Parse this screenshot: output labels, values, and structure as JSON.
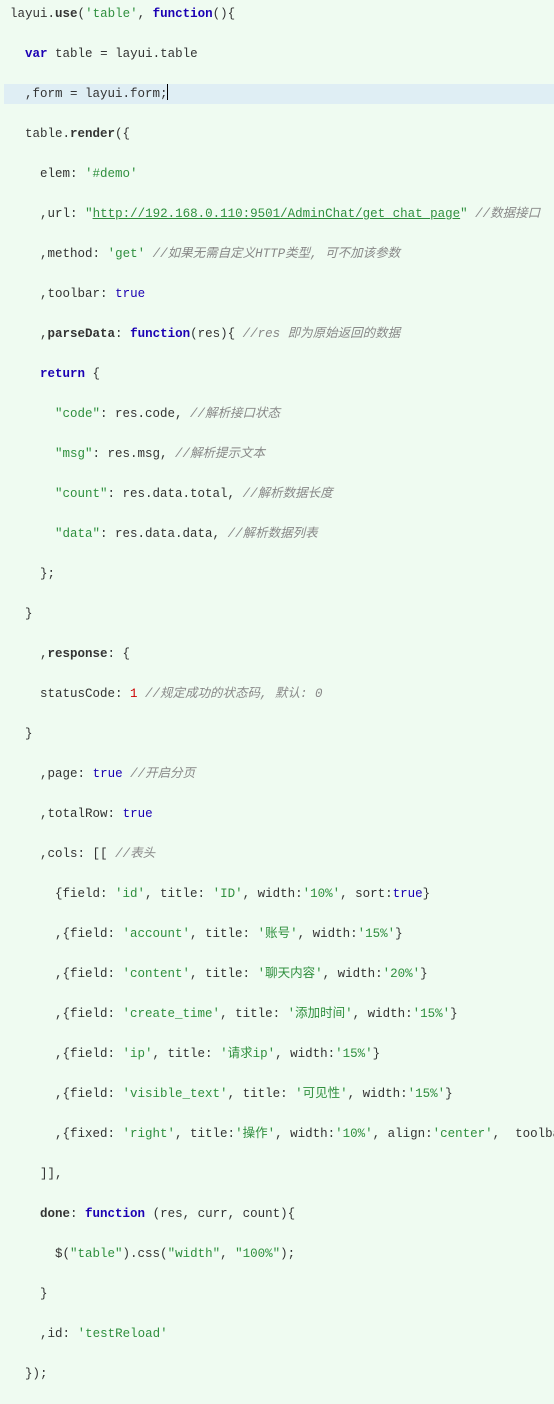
{
  "chart_data": null,
  "code": {
    "l1": {
      "fn": "layui",
      "use": "use",
      "arg": "'table'",
      "kw": "function"
    },
    "l2": {
      "kw": "var",
      "id": "table",
      "rhs": "layui.table"
    },
    "l3": {
      "lhs": ",form",
      "rhs": "layui.form;"
    },
    "l4": {
      "obj": "table.",
      "m": "render",
      "open": "({"
    },
    "l5": {
      "k": "elem",
      "v": "'#demo'"
    },
    "l6": {
      "k": "url",
      "v1": "\"",
      "url": "http://192.168.0.110:9501/AdminChat/get_chat_page",
      "v2": "\"",
      "c": " //数据接口"
    },
    "l7": {
      "k": "method",
      "v": "'get'",
      "c": " //如果无需自定义HTTP类型, 可不加该参数"
    },
    "l8": {
      "k": "toolbar",
      "v": "true"
    },
    "l9": {
      "k": "parseData",
      "fn": "function",
      "arg": "(res){",
      "c": " //res 即为原始返回的数据"
    },
    "l10": {
      "kw": "return",
      "p": " {"
    },
    "l11": {
      "k": "\"code\"",
      "v": ": res.code, ",
      "c": "//解析接口状态"
    },
    "l12": {
      "k": "\"msg\"",
      "v": ": res.msg, ",
      "c": "//解析提示文本"
    },
    "l13": {
      "k": "\"count\"",
      "v": ": res.data.total, ",
      "c": "//解析数据长度"
    },
    "l14": {
      "k": "\"data\"",
      "v": ": res.data.data, ",
      "c": "//解析数据列表"
    },
    "l15": {
      "p": "};"
    },
    "l16": {
      "p": "}"
    },
    "l17": {
      "k": "response",
      "p": ": {"
    },
    "l18": {
      "id": "statusCode: ",
      "n": "1",
      "c": " //规定成功的状态码, 默认: 0"
    },
    "l19": {
      "p": "}"
    },
    "l20": {
      "k": "page",
      "v": "true",
      "c": " //开启分页"
    },
    "l21": {
      "k": "totalRow",
      "v": "true"
    },
    "l22": {
      "k": "cols",
      "p": ": [[ ",
      "c": "//表头"
    },
    "l23": {
      "f": "'id'",
      "t": "'ID'",
      "w": "'10%'",
      "extra": ", sort:",
      "ev": "true",
      "close": "}"
    },
    "l24": {
      "f": "'account'",
      "t": "'账号'",
      "w": "'15%'",
      "close": "}"
    },
    "l25": {
      "f": "'content'",
      "t": "'聊天内容'",
      "w": "'20%'",
      "close": "}"
    },
    "l26": {
      "f": "'create_time'",
      "t": "'添加时间'",
      "w": "'15%'",
      "close": "}"
    },
    "l27": {
      "f": "'ip'",
      "t": "'请求ip'",
      "w": "'15%'",
      "close": "}"
    },
    "l28": {
      "f": "'visible_text'",
      "t": "'可见性'",
      "w": "'15%'",
      "close": "}"
    },
    "l29": {
      "fx": "'right'",
      "t": "'操作'",
      "w": "'10%'",
      "al": "'center'",
      "tail": ",  toolbar:"
    },
    "l30": {
      "p": "]],"
    },
    "l31": {
      "k": "done",
      "fn": "function",
      "arg": " (res, curr, count){"
    },
    "l32": {
      "jq": "$(",
      "sel": "\"table\"",
      "mid": ").css(",
      "a": "\"width\"",
      "com": ", ",
      "b": "\"100%\"",
      "end": ");"
    },
    "l33": {
      "p": "}"
    },
    "l34": {
      "k": "id",
      "v": "'testReload'"
    },
    "l35": {
      "p": "});"
    }
  }
}
